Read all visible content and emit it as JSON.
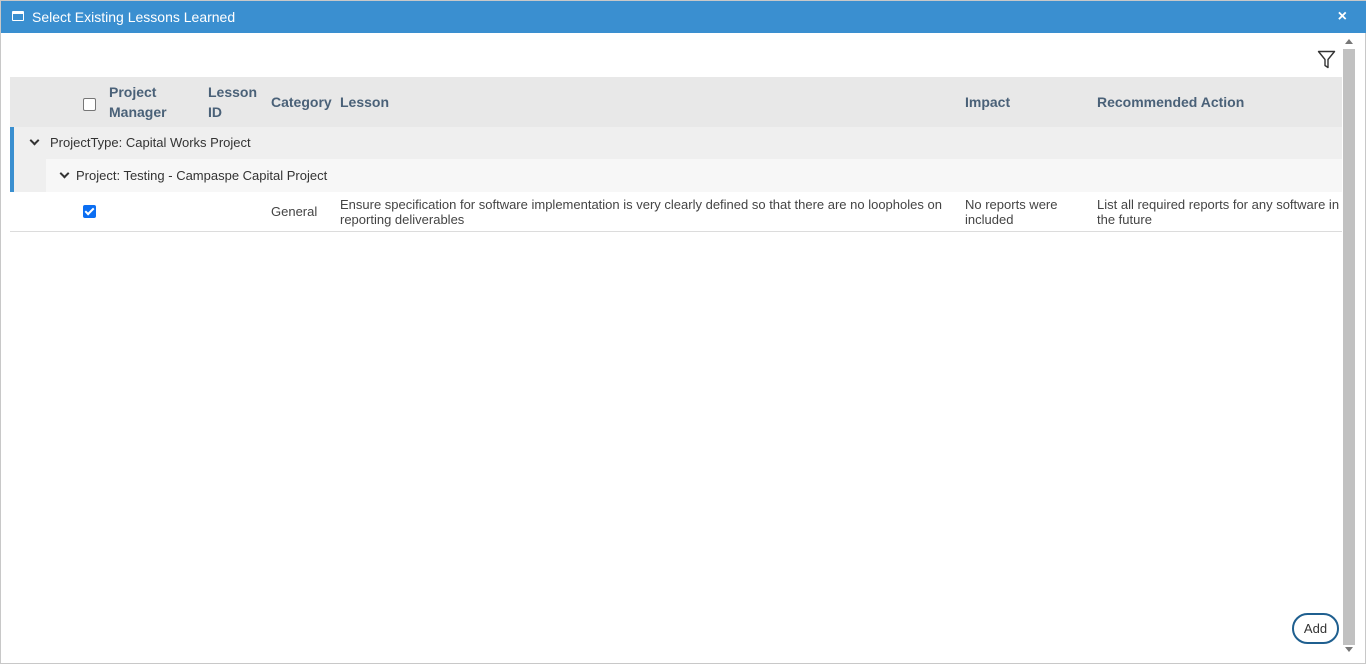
{
  "dialog": {
    "title": "Select Existing Lessons Learned",
    "close_label": "×"
  },
  "toolbar": {
    "filter_icon": "filter-icon"
  },
  "grid": {
    "columns": {
      "project_manager_line1": "Project",
      "project_manager_line2": "Manager",
      "lesson_id_line1": "Lesson",
      "lesson_id_line2": "ID",
      "category": "Category",
      "lesson": "Lesson",
      "impact": "Impact",
      "recommended_action": "Recommended Action"
    },
    "select_all_checked": false,
    "groups": {
      "project_type": "ProjectType: Capital Works Project",
      "project": "Project: Testing - Campaspe Capital Project"
    },
    "rows": [
      {
        "checked": true,
        "project_manager": "",
        "lesson_id": "",
        "category": "General",
        "lesson_line1": "Ensure specification for software implementation is very clearly defined so that there are no loopholes on",
        "lesson_line2": "reporting deliverables",
        "impact_line1": "No reports were",
        "impact_line2": "included",
        "recommended_action_line1": "List all required reports for any software in",
        "recommended_action_line2": "the future"
      }
    ]
  },
  "footer": {
    "add_label": "Add"
  },
  "colors": {
    "titlebar": "#3a8fd0",
    "header_bg": "#e8e8e8",
    "header_text": "#4a6178",
    "checkbox_checked": "#0b6ef2",
    "add_border": "#1f5f8f"
  }
}
